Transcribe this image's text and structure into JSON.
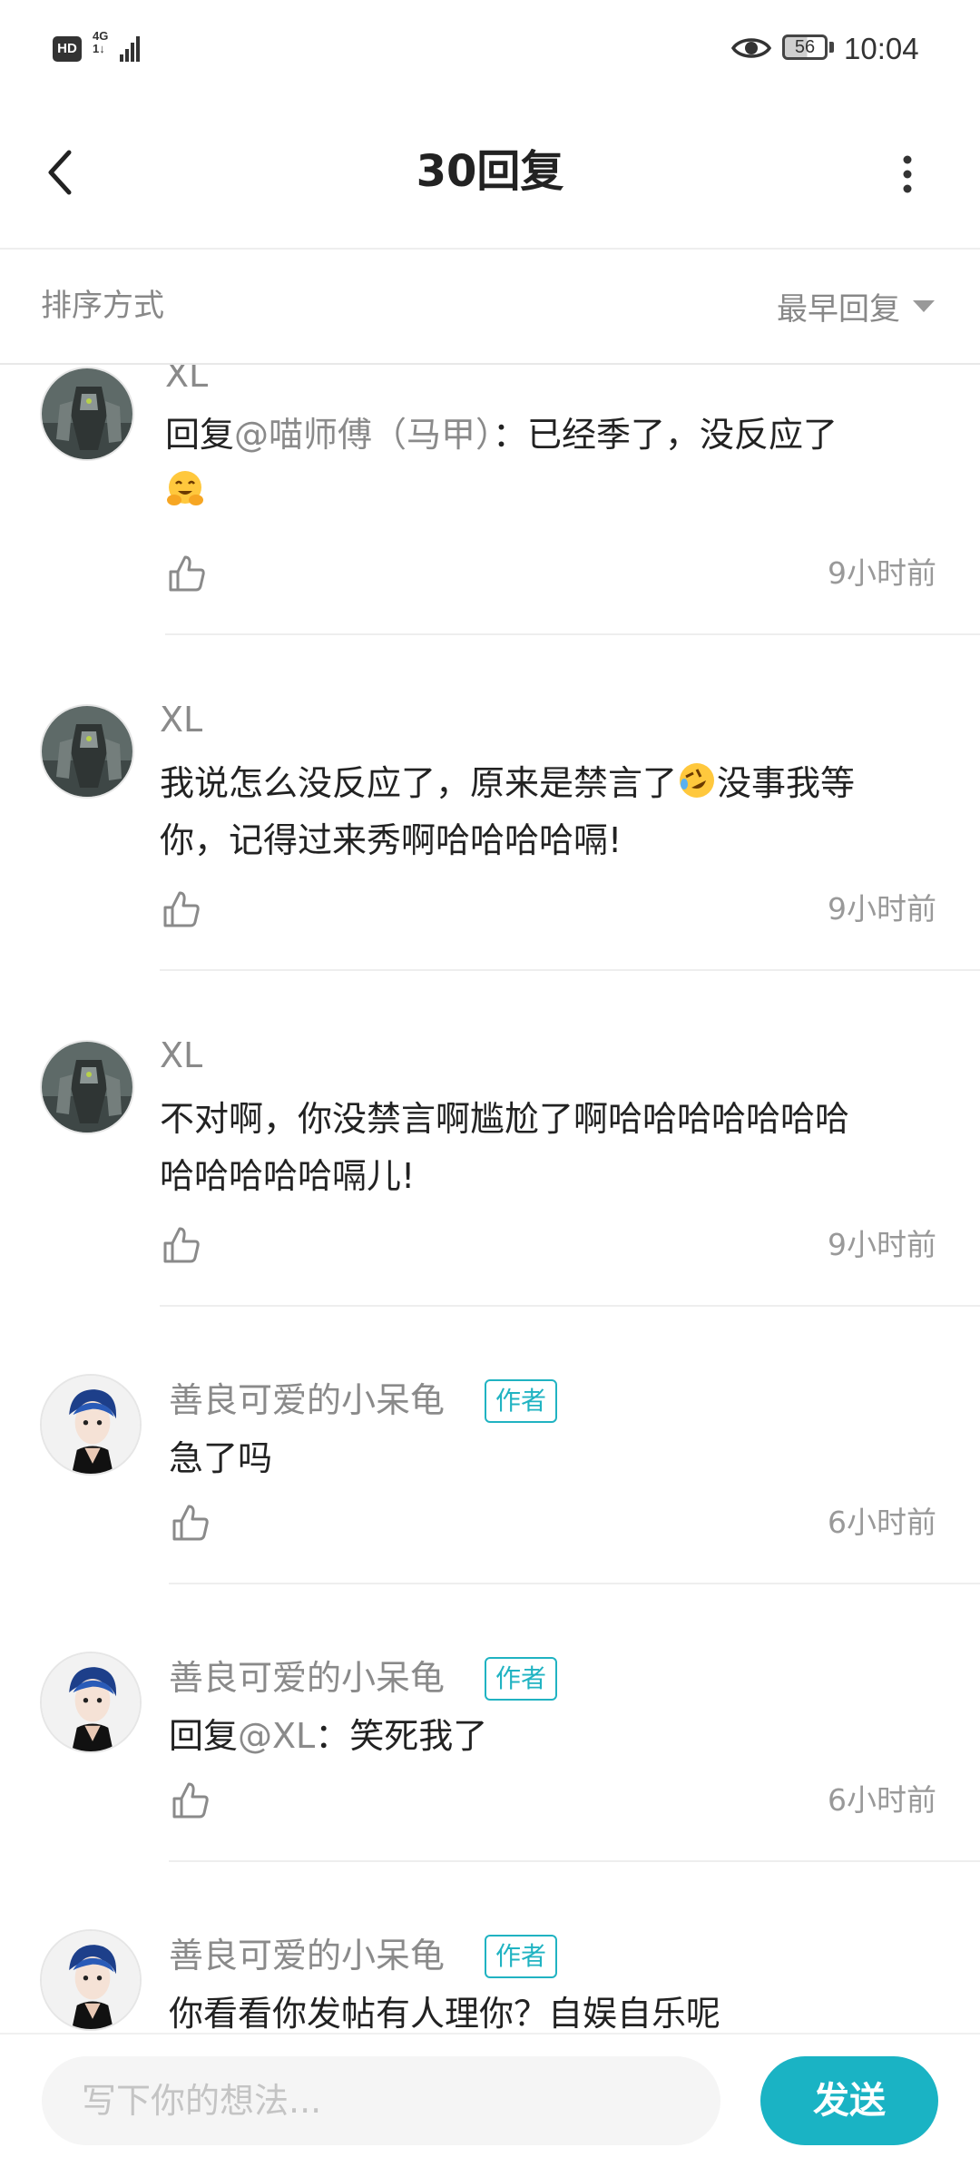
{
  "status_bar": {
    "hd_label": "HD",
    "network_label": "4G",
    "network_sub": "1↓",
    "battery_level": "56",
    "time": "10:04",
    "icons": [
      "signal-icon",
      "eye-icon",
      "battery-icon"
    ]
  },
  "header": {
    "title": "30回复",
    "back_icon": "chevron-left-icon",
    "more_icon": "more-vertical-icon"
  },
  "sort": {
    "label": "排序方式",
    "selected": "最早回复"
  },
  "replies": [
    {
      "user": "XL",
      "mention": "@喵师傅（马甲）",
      "prefix": "回复",
      "text_line1": "：已经季了，没反应了",
      "emoji": "hugging-face",
      "time": "9小时前"
    },
    {
      "user": "XL",
      "text_part1": "我说怎么没反应了，原来是禁言了",
      "emoji": "rolling-on-floor-laughing",
      "text_part2": "没事我等",
      "text_line2": "你，记得过来秀啊哈哈哈哈嗝!",
      "time": "9小时前"
    },
    {
      "user": "XL",
      "text_line1": "不对啊，你没禁言啊尴尬了啊哈哈哈哈哈哈哈",
      "text_line2": "哈哈哈哈哈嗝儿!",
      "time": "9小时前"
    },
    {
      "user": "善良可爱的小呆龟",
      "badge": "作者",
      "text": "急了吗",
      "time": "6小时前"
    },
    {
      "user": "善良可爱的小呆龟",
      "badge": "作者",
      "prefix": "回复",
      "mention": "@XL",
      "text": "：笑死我了",
      "time": "6小时前"
    },
    {
      "user": "善良可爱的小呆龟",
      "badge": "作者",
      "text": "你看看你发帖有人理你？自娱自乐呢"
    }
  ],
  "input_bar": {
    "placeholder": "写下你的想法...",
    "send_label": "发送"
  },
  "colors": {
    "accent": "#1ab3c4",
    "badge": "#20b3c2",
    "muted_text": "#8a8a8a",
    "divider": "#eeeeee"
  }
}
